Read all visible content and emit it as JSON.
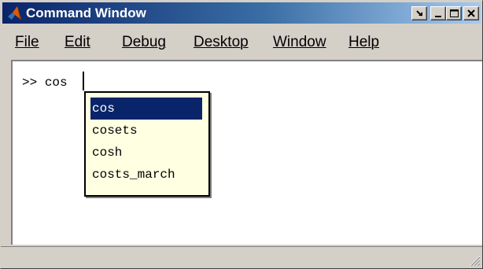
{
  "window": {
    "title": "Command Window",
    "controls": {
      "undock": "undock",
      "minimize": "minimize",
      "maximize": "maximize",
      "close": "close"
    }
  },
  "menubar": {
    "items": [
      "File",
      "Edit",
      "Debug",
      "Desktop",
      "Window",
      "Help"
    ]
  },
  "command": {
    "prompt": ">>",
    "input_value": "cos"
  },
  "autocomplete": {
    "selected_index": 0,
    "options": [
      "cos",
      "cosets",
      "cosh",
      "costs_march"
    ]
  },
  "colors": {
    "title_gradient_start": "#0a246a",
    "title_gradient_end": "#a6caf0",
    "popup_background": "#ffffe1",
    "selection": "#0a246a"
  },
  "icons": {
    "app": "matlab-logo-icon",
    "resize": "resize-grip-icon"
  }
}
